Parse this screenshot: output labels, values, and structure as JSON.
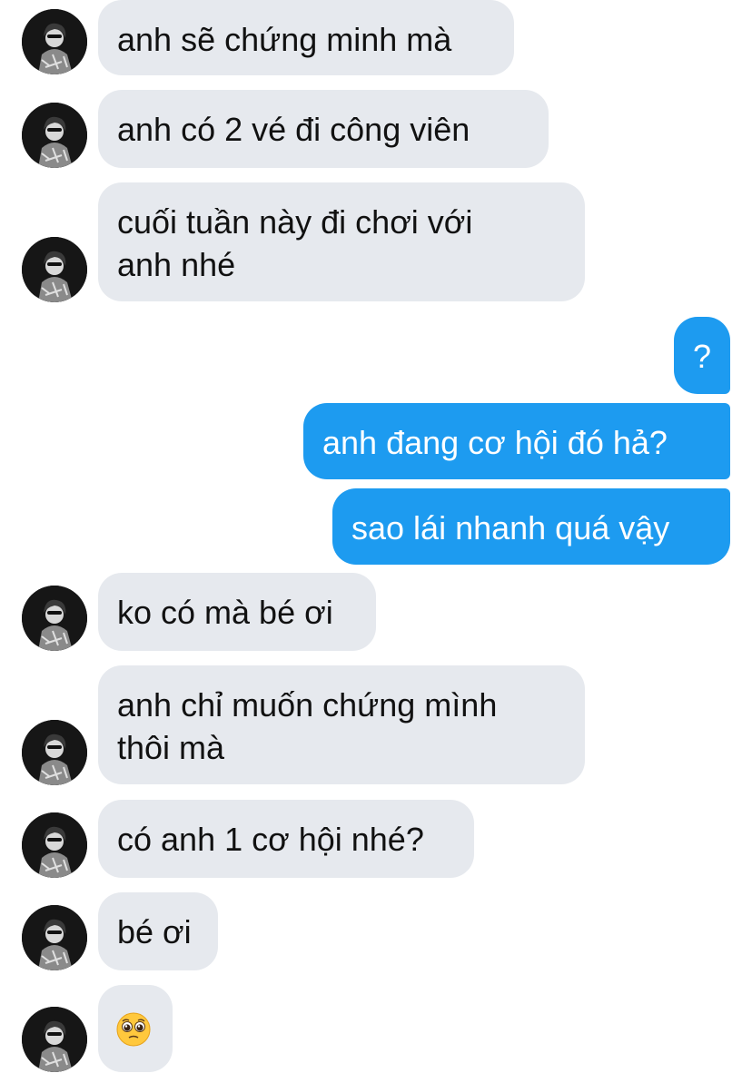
{
  "messages": [
    {
      "id": 1,
      "side": "incoming",
      "text": "anh sẽ chứng minh mà"
    },
    {
      "id": 2,
      "side": "incoming",
      "text": "anh có 2 vé đi công viên"
    },
    {
      "id": 3,
      "side": "incoming",
      "lines": [
        "cuối tuần này đi chơi với",
        "anh nhé"
      ]
    },
    {
      "id": 4,
      "side": "outgoing",
      "text": "?"
    },
    {
      "id": 5,
      "side": "outgoing",
      "text": "anh đang cơ hội đó hả?"
    },
    {
      "id": 6,
      "side": "outgoing",
      "text": "sao lái nhanh quá vậy"
    },
    {
      "id": 7,
      "side": "incoming",
      "text": "ko có mà bé ơi"
    },
    {
      "id": 8,
      "side": "incoming",
      "lines": [
        "anh chỉ muốn chứng mình",
        "thôi mà"
      ]
    },
    {
      "id": 9,
      "side": "incoming",
      "text": "có anh 1 cơ hội nhé?"
    },
    {
      "id": 10,
      "side": "incoming",
      "text": "bé ơi"
    },
    {
      "id": 11,
      "side": "incoming",
      "emoji": "pleading-face-emoji"
    }
  ],
  "colors": {
    "incoming_bubble": "#e6e9ee",
    "outgoing_bubble": "#1d9bf0",
    "incoming_text": "#111111",
    "outgoing_text": "#ffffff",
    "background": "#ffffff"
  },
  "avatar": {
    "icon": "profile-photo-avatar"
  }
}
